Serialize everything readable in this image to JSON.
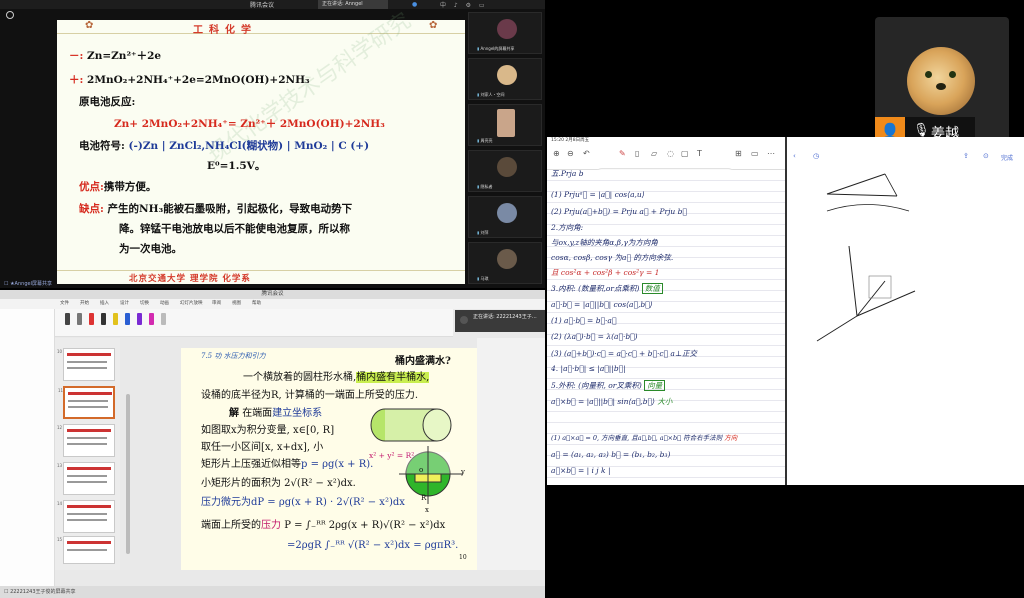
{
  "tile1": {
    "window_title": "腾讯会议",
    "sharing_chip": "正在讲话: Anngel",
    "icons_right": "中 ♪ ⚙ ▭",
    "slide_title": "工科化学",
    "lines": {
      "neg": "－: ",
      "neg_eq": "Zn=Zn²⁺＋2e",
      "pos": "＋: ",
      "pos_eq": "2MnO₂+2NH₄⁺+2e=2MnO(OH)+2NH₃",
      "reaction_label": "原电池反应:",
      "reaction": "Zn+ 2MnO₂+2NH₄⁺= Zn²⁺＋ 2MnO(OH)+2NH₃",
      "symbol_label": "电池符号: ",
      "symbol": "(-)Zn | ZnCl₂,NH₄Cl(糊状物) | MnO₂ | C (+)",
      "emf": "E⁰=1.5V。",
      "adv_label": "优点:",
      "adv": "携带方便。",
      "dis_label": "缺点:",
      "dis1": "产生的NH₃能被石墨吸附，引起极化，导致电动势下",
      "dis2": "降。锌锰干电池放电以后不能使电池复原，所以称",
      "dis3": "为一次电池。"
    },
    "footer": "北京交通大学 理学院 化学系",
    "watermark": "现代化学技术与科学研究",
    "bottom_label": "☐ ★Anngel屏幕共享",
    "participants": [
      {
        "name": "Anngel的屏幕共享",
        "color": "#6a3a4a"
      },
      {
        "name": "刘家人・空间",
        "color": "#d9b88a"
      },
      {
        "name": "周亮亮",
        "color": "#c9a58a"
      },
      {
        "name": "隐私者",
        "color": "#5a4a3a"
      },
      {
        "name": "刘萍",
        "color": "#7a8aa5"
      },
      {
        "name": "马琪",
        "color": "#6a5a4a"
      }
    ]
  },
  "tile2": {
    "window_title": "腾讯会议",
    "menu": [
      "文件",
      "开始",
      "插入",
      "设计",
      "切换",
      "动画",
      "幻灯片放映",
      "审阅",
      "视图",
      "帮助"
    ],
    "rec_text": "正在讲话: 22221243王子…",
    "thumb_nums": [
      "10",
      "11",
      "12",
      "13",
      "14",
      "15"
    ],
    "slide": {
      "section": "7.5 功 水压力和引力",
      "q": "桶内盛满水?",
      "l1a": "一个横放着的圆柱形水桶,",
      "l1b": "桶内盛有半桶水,",
      "l2": "设桶的底半径为R, 计算桶的一端面上所受的压力.",
      "l3a": "解",
      "l3b": "在端面",
      "l3c": "建立坐标系",
      "l4": "如图取x为积分变量, x∈[0, R]",
      "l5": "取任一小区间[x, x+dx], 小",
      "l6a": "矩形片上压强近似相等",
      "l6b": "p = ρg(x + R).",
      "l7": "小矩形片的面积为 2√(R² − x²)dx.",
      "l8a": "压力微元为",
      "l8b": "dP = ρg(x + R) · 2√(R² − x²)dx",
      "l9a": "端面上所受的",
      "l9b": "压力",
      "l9c": "P = ∫₋ᴿᴿ 2ρg(x + R)√(R² − x²)dx",
      "l10": "=2ρgR ∫₋ᴿᴿ √(R² − x²)dx = ρgπR³.",
      "circle_eq": "x² + y² = R²",
      "page": "10",
      "axis_o": "o",
      "axis_x": "x",
      "axis_y": "y",
      "axis_r": "R"
    },
    "status": "☐ 22221243王子俊的屏幕共享"
  },
  "tile3": {
    "cam_name": "姜越",
    "pad_status": "15:20  2月8日周五",
    "done": "完成",
    "notes": [
      "五.Prja b",
      "(1) Prjuᵃ⃗ = |a⃗| cos⟨a,u⟩",
      "(2) Prju(a⃗+b⃗) = Prju a⃗ + Prju b⃗",
      "2.方向角:",
      "与ox,y,z轴的夹角α,β,γ为方向角",
      "cosα, cosβ, cosγ 为a⃗ 的方向余弦.",
      "且 cos²α + cos²β + cos²γ = 1",
      "3.内积: (数量积,or点乘积)",
      "a⃗·b⃗ = |a⃗||b⃗| cos⟨a⃗,b⃗⟩",
      "(1) a⃗·b⃗ = b⃗·a⃗",
      "(2) (λa⃗)·b⃗ = λ(a⃗·b⃗)",
      "(3) (a⃗+b⃗)·c⃗ = a⃗·c⃗ + b⃗·c⃗   a⊥正交",
      "4. |a⃗·b⃗| ≤ |a⃗||b⃗|",
      "5.外积: (向量积, or叉乘积)",
      "a⃗×b⃗ = |a⃗||b⃗| sin⟨a⃗,b⃗⟩",
      "(1) a⃗×a⃗ = 0, 方向垂直, 且a⃗,b⃗, a⃗×b⃗ 符合右手法则",
      "a⃗ = (a₁, a₂, a₃)   b⃗ = (b₁, b₂, b₃)",
      "a⃗×b⃗ = | i  j  k |"
    ],
    "box_scalar": "数值",
    "box_vector": "向量",
    "note_big": "大小",
    "note_dir": "方向"
  }
}
